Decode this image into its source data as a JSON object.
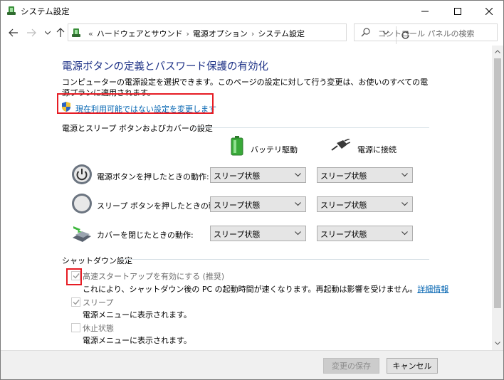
{
  "window": {
    "title": "システム設定"
  },
  "address": {
    "crumbs": [
      "ハードウェアとサウンド",
      "電源オプション",
      "システム設定"
    ],
    "search_placeholder": "コントロール パネルの検索"
  },
  "main": {
    "heading": "電源ボタンの定義とパスワード保護の有効化",
    "description": "コンピューターの電源設定を選択できます。このページの設定に対して行う変更は、お使いのすべての電源プランに適用されます。",
    "change_link": "現在利用可能ではない設定を変更します",
    "power_section": {
      "label": "電源とスリープ ボタンおよびカバーの設定",
      "columns": [
        "バッテリ駆動",
        "電源に接続"
      ],
      "rows": [
        {
          "label": "電源ボタンを押したときの動作:",
          "battery": "スリープ状態",
          "plugged": "スリープ状態",
          "icon": "power-button-icon"
        },
        {
          "label": "スリープ ボタンを押したときの動作:",
          "battery": "スリープ状態",
          "plugged": "スリープ状態",
          "icon": "sleep-button-icon"
        },
        {
          "label": "カバーを閉じたときの動作:",
          "battery": "スリープ状態",
          "plugged": "スリープ状態",
          "icon": "laptop-lid-icon"
        }
      ]
    },
    "shutdown_section": {
      "label": "シャットダウン設定",
      "items": [
        {
          "label": "高速スタートアップを有効にする (推奨)",
          "desc": "これにより、シャットダウン後の PC の起動時間が速くなります。再起動は影響を受けません。",
          "link": "詳細情報",
          "checked": true
        },
        {
          "label": "スリープ",
          "desc": "電源メニューに表示されます。",
          "checked": true
        },
        {
          "label": "休止状態",
          "desc": "電源メニューに表示されます。",
          "checked": false
        }
      ]
    }
  },
  "footer": {
    "save_label": "変更の保存",
    "cancel_label": "キャンセル"
  },
  "colors": {
    "heading": "#1e3287",
    "link": "#0063b1",
    "highlight": "#e61c24"
  }
}
